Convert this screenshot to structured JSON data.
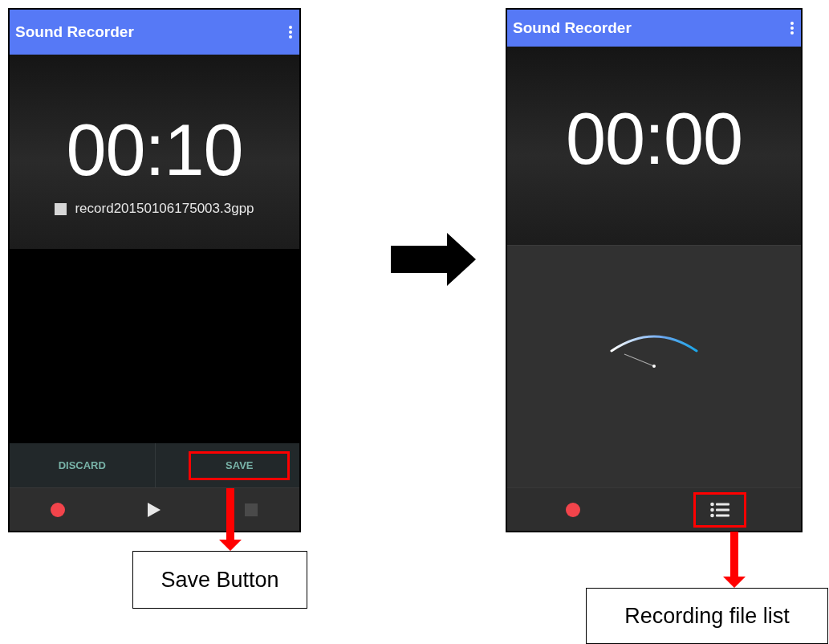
{
  "screens": [
    {
      "kind": "saved",
      "title": "Sound Recorder",
      "timer": "00:10",
      "file_name": "record20150106175003.3gpp",
      "actions": [
        {
          "label": "DISCARD",
          "highlighted": false
        },
        {
          "label": "SAVE",
          "highlighted": true
        }
      ],
      "controls": [
        {
          "kind": "record",
          "disabled": false,
          "highlighted": false
        },
        {
          "kind": "play",
          "disabled": false,
          "highlighted": false
        },
        {
          "kind": "stop",
          "disabled": true,
          "highlighted": false
        }
      ]
    },
    {
      "kind": "ready",
      "title": "Sound Recorder",
      "timer": "00:00",
      "controls": [
        {
          "kind": "record",
          "disabled": false,
          "highlighted": false
        },
        {
          "kind": "list",
          "disabled": false,
          "highlighted": true
        }
      ]
    }
  ],
  "callouts": [
    {
      "text": "Save Button"
    },
    {
      "text": "Recording file list"
    }
  ]
}
